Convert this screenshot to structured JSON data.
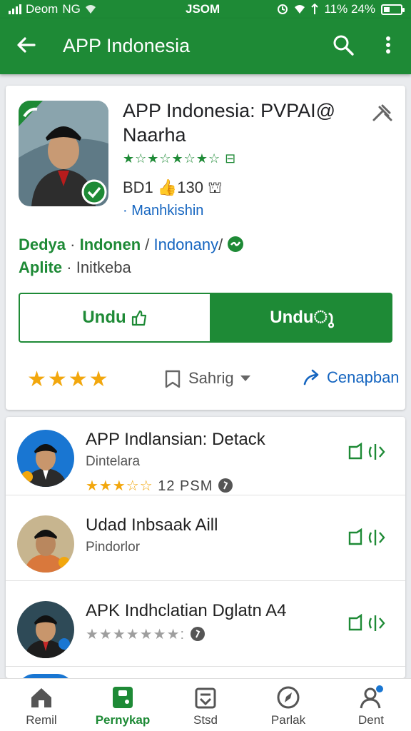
{
  "status_bar": {
    "carrier": "Deom",
    "network": "NG",
    "time": "JSOM",
    "battery_text": "11% 24%"
  },
  "app_bar": {
    "title": "APP Indonesia"
  },
  "app": {
    "name": "APP Indonesia: PVPAI@ Naarha",
    "rating_stars": "★☆★☆★☆★☆ ⊟",
    "downloads": "BD1 👍130 ⛫",
    "publisher": "· Manhkishin",
    "meta_line1": {
      "a": "Dedya",
      "b": "Indonen",
      "c": "Indonany",
      "sep1": "·",
      "sep2": "/",
      "sep3": "/"
    },
    "meta_line2": {
      "a": "Aplite",
      "sep": "·",
      "b": "Initkeba"
    }
  },
  "actions": {
    "download_outline": "Undu",
    "download_fill": "Unduു"
  },
  "bottom": {
    "stars": "★★★★",
    "share_label": "Sahrig",
    "publish_label": "Cenapban"
  },
  "list": [
    {
      "name": "APP Indlansian: Detack",
      "sub": "Dintelara",
      "stars": "★★★☆☆",
      "extra": "12 PSM"
    },
    {
      "name": "Udad Inbsaak Aill",
      "sub": "Pindorlor"
    },
    {
      "name": "APK Indhclatian Dglatn A4",
      "stars": "★★★★★★★:"
    }
  ],
  "nav": [
    {
      "label": "Remil"
    },
    {
      "label": "Pernykap"
    },
    {
      "label": "Stsd"
    },
    {
      "label": "Parlak"
    },
    {
      "label": "Dent"
    }
  ],
  "colors": {
    "primary": "#1e8a36",
    "link": "#1565c0",
    "star": "#f2a70d"
  }
}
